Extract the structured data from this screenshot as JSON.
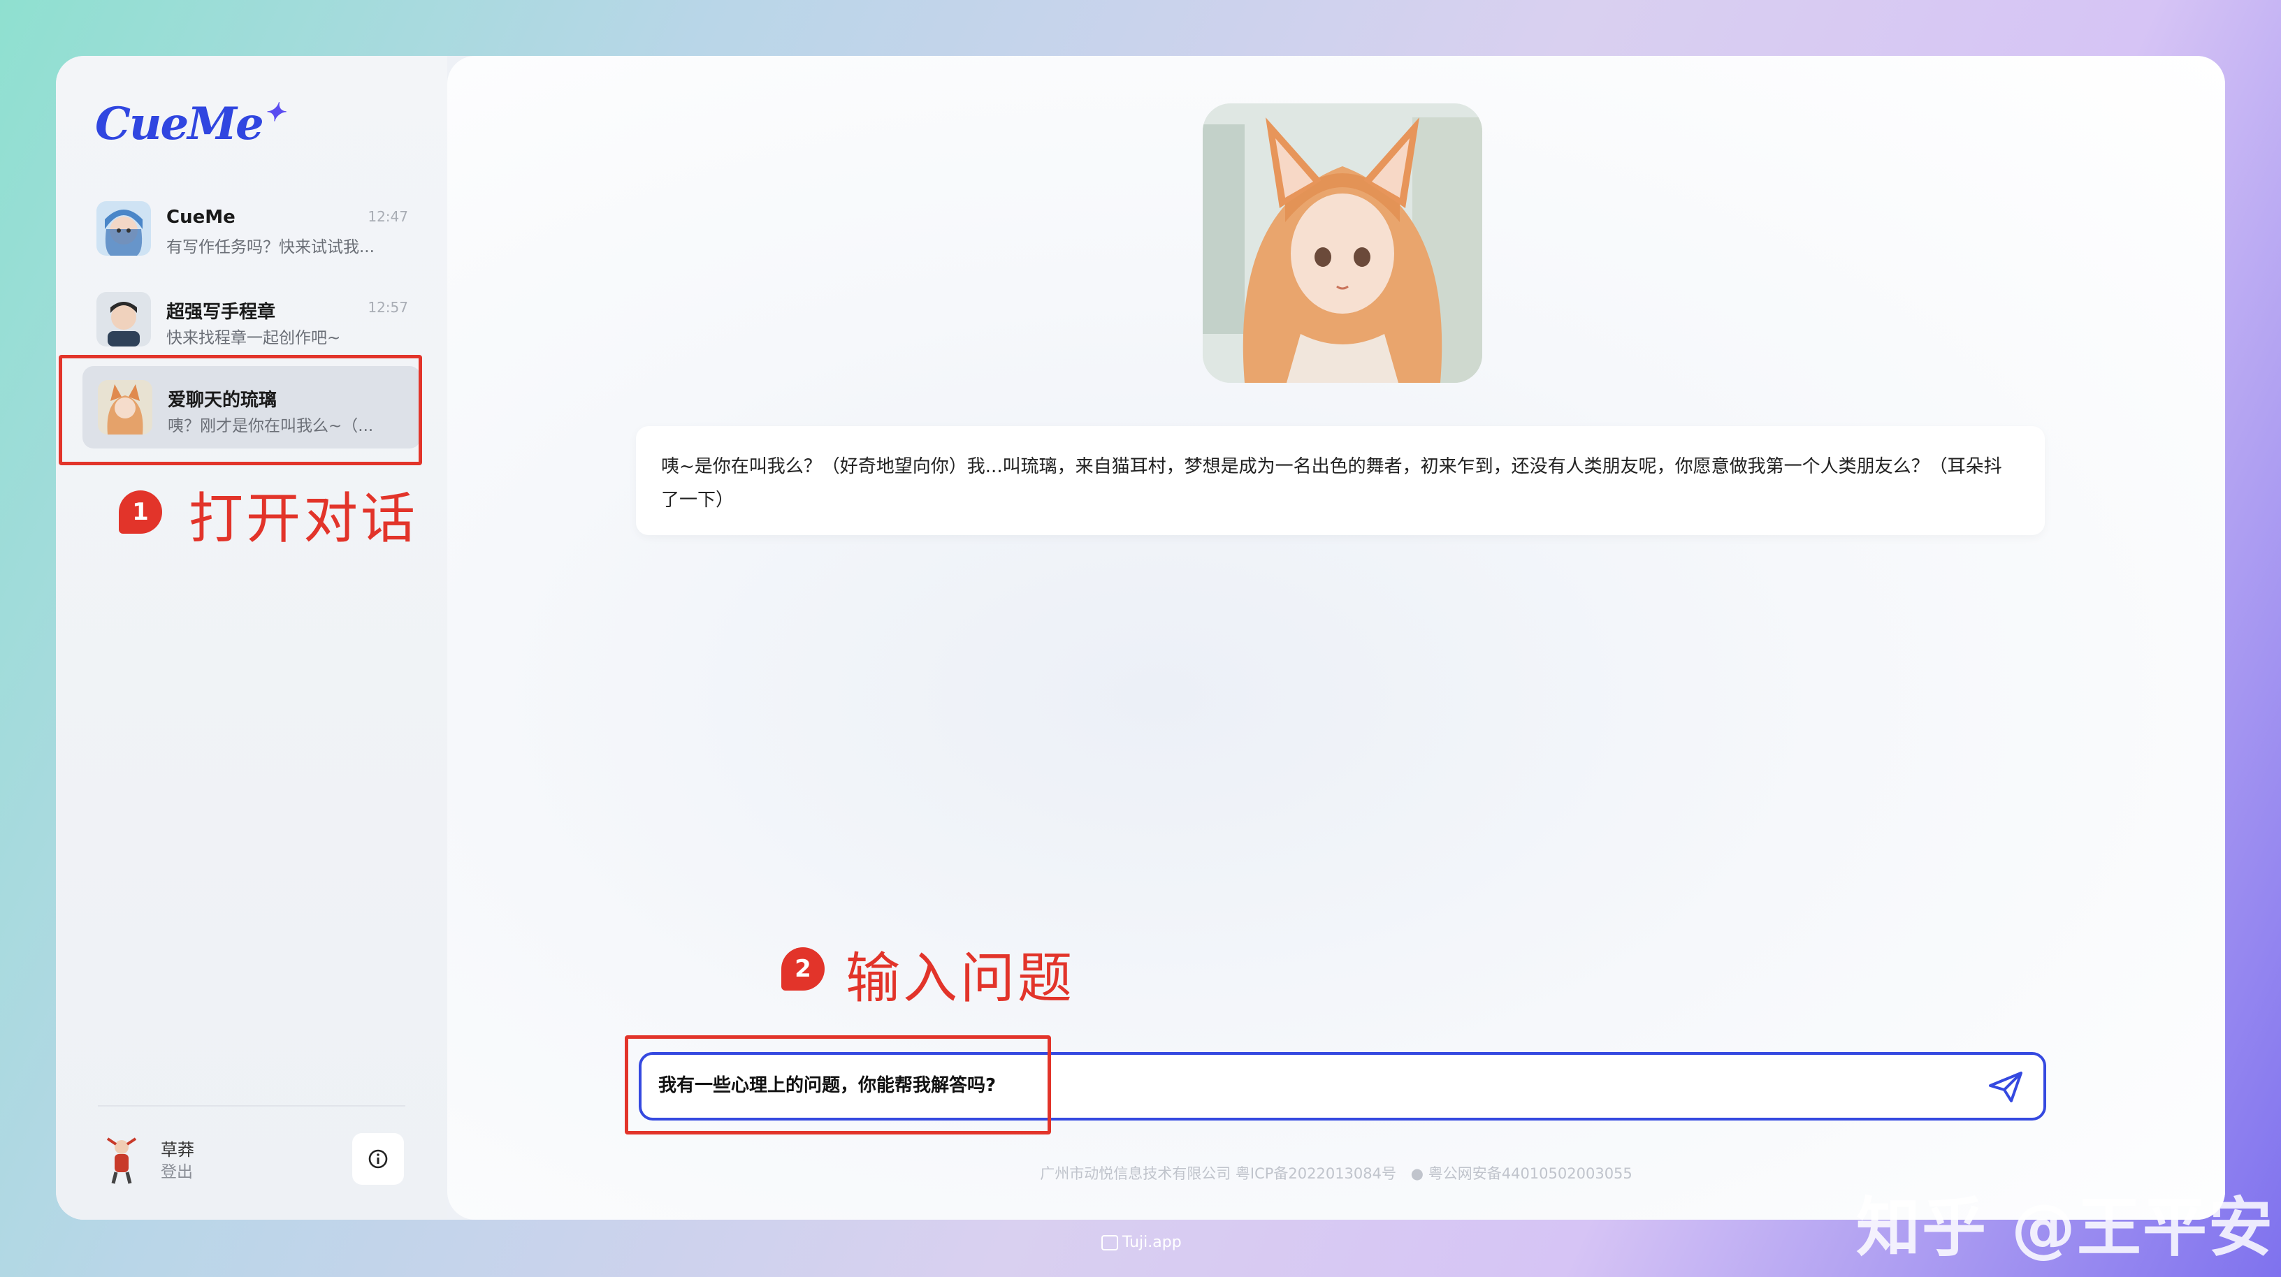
{
  "app": {
    "logo_text": "CueMe",
    "logo_spark": "✦"
  },
  "sidebar": {
    "chats": [
      {
        "name": "CueMe",
        "time": "12:47",
        "preview": "有写作任务吗？快来试试我...",
        "avatar": "girl-blue-hair-avatar"
      },
      {
        "name": "超强写手程章",
        "time": "12:57",
        "preview": "快来找程章一起创作吧~",
        "avatar": "boy-avatar"
      },
      {
        "name": "爱聊天的琉璃",
        "time": "",
        "preview": "咦？刚才是你在叫我么~（...",
        "avatar": "fox-girl-avatar"
      }
    ],
    "user": {
      "name": "草莽",
      "logout": "登出"
    }
  },
  "annotations": {
    "step1_number": "1",
    "step1_text": "打开对话",
    "step2_number": "2",
    "step2_text": "输入问题",
    "color": "#e2342a"
  },
  "chat": {
    "message": "咦~是你在叫我么？（好奇地望向你）我...叫琉璃，来自猫耳村，梦想是成为一名出色的舞者，初来乍到，还没有人类朋友呢，你愿意做我第一个人类朋友么？（耳朵抖了一下）",
    "input_value": "我有一些心理上的问题，你能帮我解答吗?"
  },
  "footer": {
    "company": "广州市动悦信息技术有限公司 粤ICP备2022013084号",
    "police": "粤公网安备44010502003055"
  },
  "watermark": "知乎 @王平安",
  "tuji": "Tuji.app",
  "colors": {
    "accent": "#3549e0",
    "annotation": "#e2342a"
  }
}
